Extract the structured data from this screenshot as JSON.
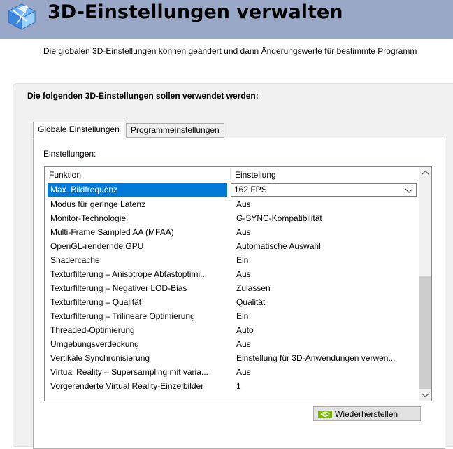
{
  "header": {
    "title": "3D-Einstellungen verwalten",
    "icon": "nvidia-3d-cube-icon"
  },
  "subtitle": "Die globalen 3D-Einstellungen können geändert und dann Änderungswerte für bestimmte Programm",
  "panel": {
    "heading": "Die folgenden 3D-Einstellungen sollen verwendet werden:",
    "tabs": [
      {
        "label": "Globale Einstellungen",
        "active": true
      },
      {
        "label": "Programmeinstellungen",
        "active": false
      }
    ],
    "settings_label": "Einstellungen:",
    "columns": {
      "function": "Funktion",
      "setting": "Einstellung"
    },
    "rows": [
      {
        "function": "Max. Bildfrequenz",
        "value": "162 FPS",
        "selected": true
      },
      {
        "function": "Modus für geringe Latenz",
        "value": "Aus"
      },
      {
        "function": "Monitor-Technologie",
        "value": "G-SYNC-Kompatibilität"
      },
      {
        "function": "Multi-Frame Sampled AA (MFAA)",
        "value": "Aus"
      },
      {
        "function": "OpenGL-rendernde GPU",
        "value": "Automatische Auswahl"
      },
      {
        "function": "Shadercache",
        "value": "Ein"
      },
      {
        "function": "Texturfilterung – Anisotrope Abtastoptimi...",
        "value": "Aus"
      },
      {
        "function": "Texturfilterung – Negativer LOD-Bias",
        "value": "Zulassen"
      },
      {
        "function": "Texturfilterung – Qualität",
        "value": "Qualität"
      },
      {
        "function": "Texturfilterung – Trilineare Optimierung",
        "value": "Ein"
      },
      {
        "function": "Threaded-Optimierung",
        "value": "Auto"
      },
      {
        "function": "Umgebungsverdeckung",
        "value": "Aus"
      },
      {
        "function": "Vertikale Synchronisierung",
        "value": "Einstellung für 3D-Anwendungen verwen..."
      },
      {
        "function": "Virtual Reality – Supersampling mit varia...",
        "value": "Aus"
      },
      {
        "function": "Vorgerenderte Virtual Reality-Einzelbilder",
        "value": "1"
      }
    ],
    "scrollbar": {
      "thumb_start_fraction": 0.46,
      "thumb_end_fraction": 1.0
    },
    "restore_button": {
      "label": "Wiederherstellen",
      "icon": "nvidia-logo-icon"
    }
  },
  "colors": {
    "header_bg": "#9aa8c8",
    "selection": "#0078d7",
    "nvidia_green": "#76b900"
  }
}
